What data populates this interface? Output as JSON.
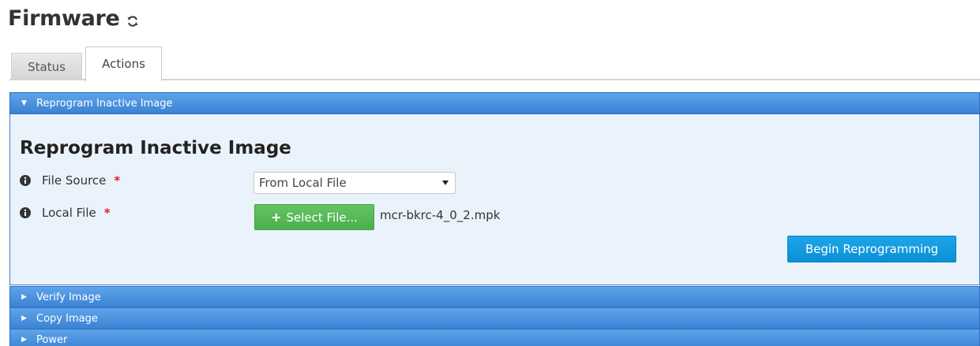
{
  "header": {
    "title": "Firmware",
    "refresh_icon": "refresh-icon"
  },
  "tabs": [
    {
      "label": "Status",
      "active": false
    },
    {
      "label": "Actions",
      "active": true
    }
  ],
  "accordion": {
    "sections": [
      {
        "label": "Reprogram Inactive Image",
        "expanded": true
      },
      {
        "label": "Verify Image",
        "expanded": false
      },
      {
        "label": "Copy Image",
        "expanded": false
      },
      {
        "label": "Power",
        "expanded": false
      }
    ]
  },
  "reprogram": {
    "title": "Reprogram Inactive Image",
    "file_source_label": "File Source",
    "local_file_label": "Local File",
    "required_marker": "*",
    "file_source_value": "From Local File",
    "select_file_label": "Select File...",
    "selected_file_name": "mcr-bkrc-4_0_2.mpk",
    "begin_button_label": "Begin Reprogramming"
  },
  "colors": {
    "accordion_header": "#3b82d4",
    "panel_bg": "#eaf3fb",
    "select_file_button": "#4cae4c",
    "begin_button": "#0a8fd6",
    "required": "#d9232d"
  }
}
